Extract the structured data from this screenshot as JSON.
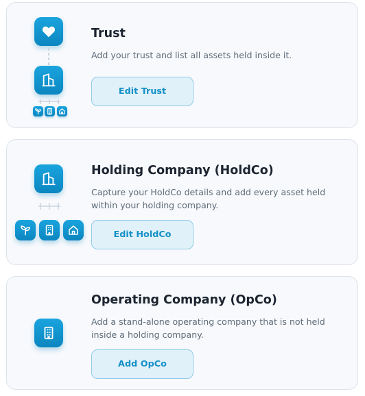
{
  "cards": [
    {
      "title": "Trust",
      "description": "Add your trust and list all assets held inside it.",
      "button_label": "Edit Trust",
      "icons": [
        "heart-icon",
        "building-icon",
        "sprout-icon",
        "office-icon",
        "home-icon"
      ]
    },
    {
      "title": "Holding Company (HoldCo)",
      "description": "Capture your HoldCo details and add every asset held within your holding company.",
      "button_label": "Edit HoldCo",
      "icons": [
        "building-icon",
        "sprout-icon",
        "office-icon",
        "home-icon"
      ]
    },
    {
      "title": "Operating Company (OpCo)",
      "description": "Add a stand-alone operating company that is not held inside a holding company.",
      "button_label": "Add OpCo",
      "icons": [
        "office-icon"
      ]
    }
  ],
  "colors": {
    "accent": "#1590c7",
    "icon_tile": "#0b86c0",
    "button_bg": "#e1f1fa",
    "button_border": "#8fcbe8",
    "card_bg": "#f7f9fc",
    "card_border": "#dde3ea",
    "title": "#1c2430",
    "description": "#5f6b78"
  }
}
